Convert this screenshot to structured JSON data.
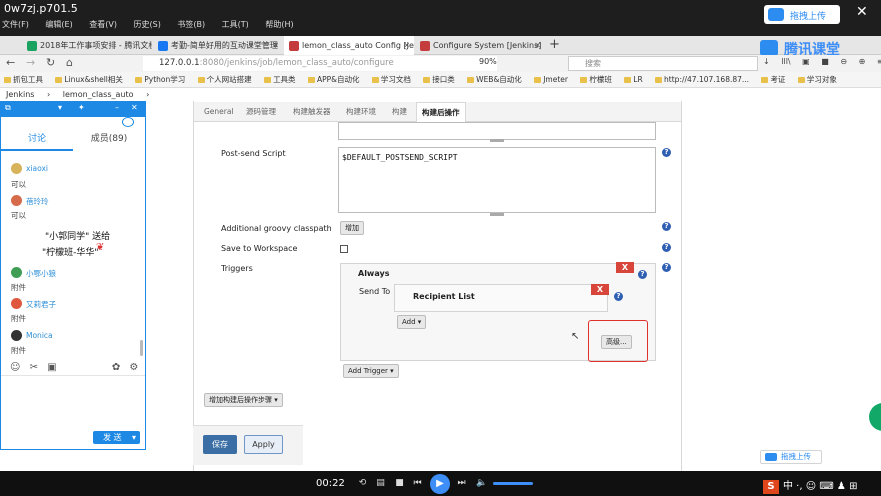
{
  "window": {
    "title": "0w7zj.p701.5",
    "menus": [
      "文件(F)",
      "编辑(E)",
      "查看(V)",
      "历史(S)",
      "书签(B)",
      "工具(T)",
      "帮助(H)"
    ],
    "share_label": "拖拽上传"
  },
  "tabs": [
    {
      "label": "2018年工作事项安排 - 腾讯文档",
      "color": "#1aa260"
    },
    {
      "label": "考勤-简单好用的互动课堂管理",
      "color": "#1877f2"
    },
    {
      "label": "lemon_class_auto Config [Je",
      "color": "#c53c3c"
    },
    {
      "label": "Configure System [Jenkins]",
      "color": "#c53c3c"
    }
  ],
  "brand": "腾讯课堂",
  "address": {
    "host": "127.0.0.1",
    "path": ":8080/jenkins/job/lemon_class_auto/configure",
    "zoom": "90%",
    "search_placeholder": "搜索"
  },
  "toolbar_icons": [
    "↓",
    "lll\\",
    "▣",
    "■",
    "⊖",
    "⊕",
    "≡"
  ],
  "bookmarks": [
    "抓包工具",
    "Linux&shell相关",
    "Python学习",
    "个人网站搭建",
    "工具类",
    "APP&自动化",
    "学习文档",
    "接口类",
    "WEB&自动化",
    "Jmeter",
    "柠檬班",
    "LR",
    "http://47.107.168.87...",
    "考证",
    "学习对象"
  ],
  "breadcrumb": [
    "Jenkins",
    "lemon_class_auto"
  ],
  "config_tabs": [
    "General",
    "源码管理",
    "构建触发器",
    "构建环境",
    "构建",
    "构建后操作"
  ],
  "form": {
    "post_send_label": "Post-send Script",
    "post_send_value": "$DEFAULT_POSTSEND_SCRIPT",
    "classpath_label": "Additional groovy classpath",
    "add_label": "增加",
    "save_ws_label": "Save to Workspace",
    "triggers_label": "Triggers",
    "always_label": "Always",
    "send_to_label": "Send To",
    "recipient_label": "Recipient List",
    "add_btn": "Add",
    "advanced_btn": "高级...",
    "add_trigger_btn": "Add Trigger",
    "add_post_step": "增加构建后操作步骤",
    "save_btn": "保存",
    "apply_btn": "Apply",
    "x": "X",
    "help": "?"
  },
  "chat": {
    "tab_discuss": "讨论",
    "tab_members": "成员(89)",
    "messages": [
      {
        "name": "xiaoxi",
        "text": "可以",
        "avatar": "#d7b35a"
      },
      {
        "name": "蓓玲玲",
        "text": "可以",
        "avatar": "#d56b4a"
      },
      {
        "name": "小鄂小狼",
        "text": "附件",
        "avatar": "#3f9d54"
      },
      {
        "name": "又莉君子",
        "text": "附件",
        "avatar": "#e0573f"
      },
      {
        "name": "Monica",
        "text": "附件",
        "avatar": "#333333"
      }
    ],
    "gift_line1": "\"小郭同学\" 送给",
    "gift_line2": "\"柠檬班-华华\"",
    "send_label": "发 送",
    "tools": [
      "☺",
      "✂",
      "▣"
    ]
  },
  "player": {
    "time": "00:22"
  },
  "tray_text": "中 ·, ☺ ⌨ ♟ ⊞"
}
